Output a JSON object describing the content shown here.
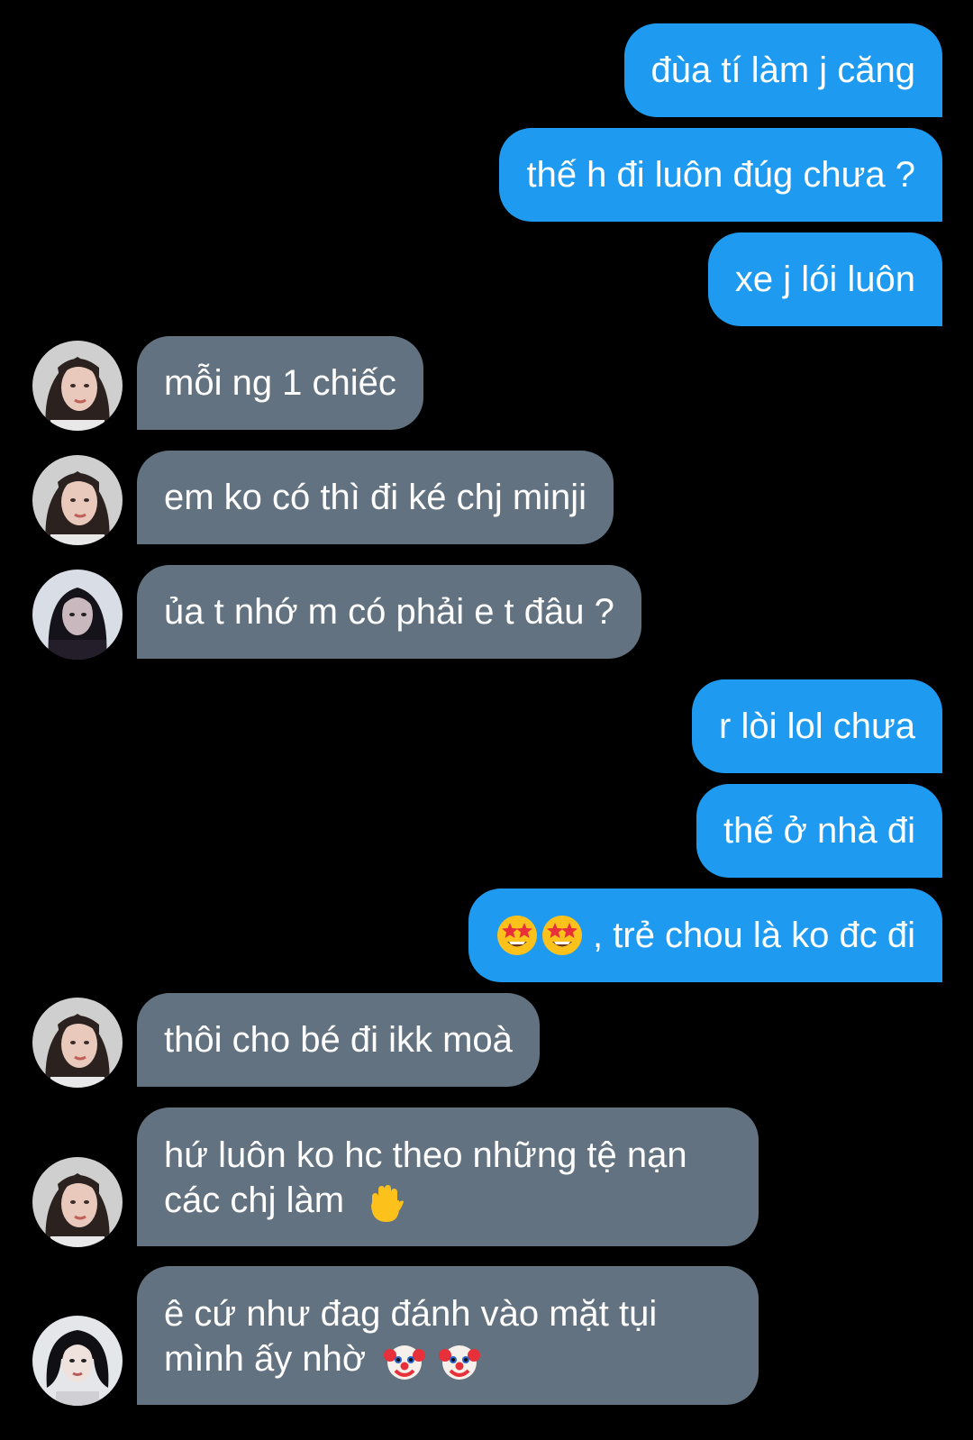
{
  "colors": {
    "background": "#000000",
    "sent_bubble": "#1e9bf0",
    "received_bubble": "#637280",
    "text": "#ffffff"
  },
  "messages": [
    {
      "id": "m1",
      "direction": "sent",
      "text": "đùa tí làm j căng"
    },
    {
      "id": "m2",
      "direction": "sent",
      "text": "thế h đi luôn đúg chưa ?"
    },
    {
      "id": "m3",
      "direction": "sent",
      "text": "xe j lói luôn"
    },
    {
      "id": "m4",
      "direction": "received",
      "avatar": "avatar-girl-long-hair",
      "text": "mỗi ng 1 chiếc"
    },
    {
      "id": "m5",
      "direction": "received",
      "avatar": "avatar-girl-long-hair",
      "text": "em ko có thì đi ké chj minji"
    },
    {
      "id": "m6",
      "direction": "received",
      "avatar": "avatar-girl-dark",
      "text": "ủa t nhớ m có phải e t đâu ?"
    },
    {
      "id": "m7",
      "direction": "sent",
      "text": "r lòi lol chưa"
    },
    {
      "id": "m8",
      "direction": "sent",
      "text": "thế ở nhà đi"
    },
    {
      "id": "m9",
      "direction": "sent",
      "emoji_before": [
        "star-struck-emoji",
        "star-struck-emoji"
      ],
      "text": ", trẻ chou là ko đc đi"
    },
    {
      "id": "m10",
      "direction": "received",
      "avatar": "avatar-girl-long-hair",
      "text": "thôi cho bé đi ikk moà"
    },
    {
      "id": "m11",
      "direction": "received",
      "avatar": "avatar-girl-long-hair",
      "lines": [
        "hứ luôn ko hc theo những tệ nạn",
        "các chj làm"
      ],
      "emoji_after": [
        "raised-hand-emoji"
      ]
    },
    {
      "id": "m12",
      "direction": "received",
      "avatar": "avatar-girl-bob",
      "lines": [
        "ê cứ như đag đánh vào mặt tụi",
        "mình ấy nhờ"
      ],
      "emoji_after": [
        "clown-face-emoji",
        "clown-face-emoji"
      ]
    }
  ]
}
